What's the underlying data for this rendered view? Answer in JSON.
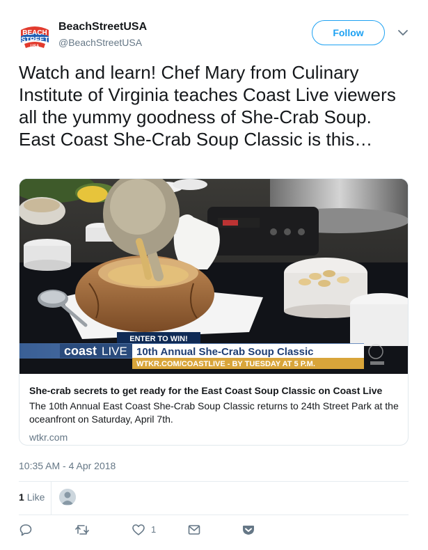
{
  "user": {
    "display_name": "BeachStreetUSA",
    "handle": "@BeachStreetUSA",
    "avatar_icon": "beach-street-usa-logo",
    "follow_label": "Follow"
  },
  "tweet": {
    "text": "Watch and learn! Chef Mary from Culinary Institute of Virginia teaches Coast Live viewers all the yummy goodness of She-Crab Soup. East Coast She-Crab Soup Classic is this…"
  },
  "card": {
    "overlay": {
      "enter": "ENTER TO WIN!",
      "show_name_bold": "coast",
      "show_name_light": "LIVE",
      "headline": "10th Annual She-Crab Soup Classic",
      "subline": "WTKR.COM/COASTLIVE - BY TUESDAY AT 5 P.M."
    },
    "title": "She-crab secrets to get ready for the East Coast Soup Classic on Coast Live",
    "description": "The 10th Annual East Coast She-Crab Soup Classic returns to  24th Street Park at the oceanfront on Saturday, April 7th.",
    "domain": "wtkr.com"
  },
  "timestamp": "10:35 AM - 4 Apr 2018",
  "stats": {
    "likes_count": "1",
    "likes_label": "Like"
  },
  "actions": {
    "reply_icon": "reply-icon",
    "retweet_icon": "retweet-icon",
    "like_icon": "heart-icon",
    "like_count": "1",
    "dm_icon": "envelope-icon",
    "save_icon": "pocket-icon"
  },
  "colors": {
    "accent": "#1da1f2",
    "secondary_text": "#657786",
    "text": "#14171a",
    "border": "#e1e8ed"
  }
}
